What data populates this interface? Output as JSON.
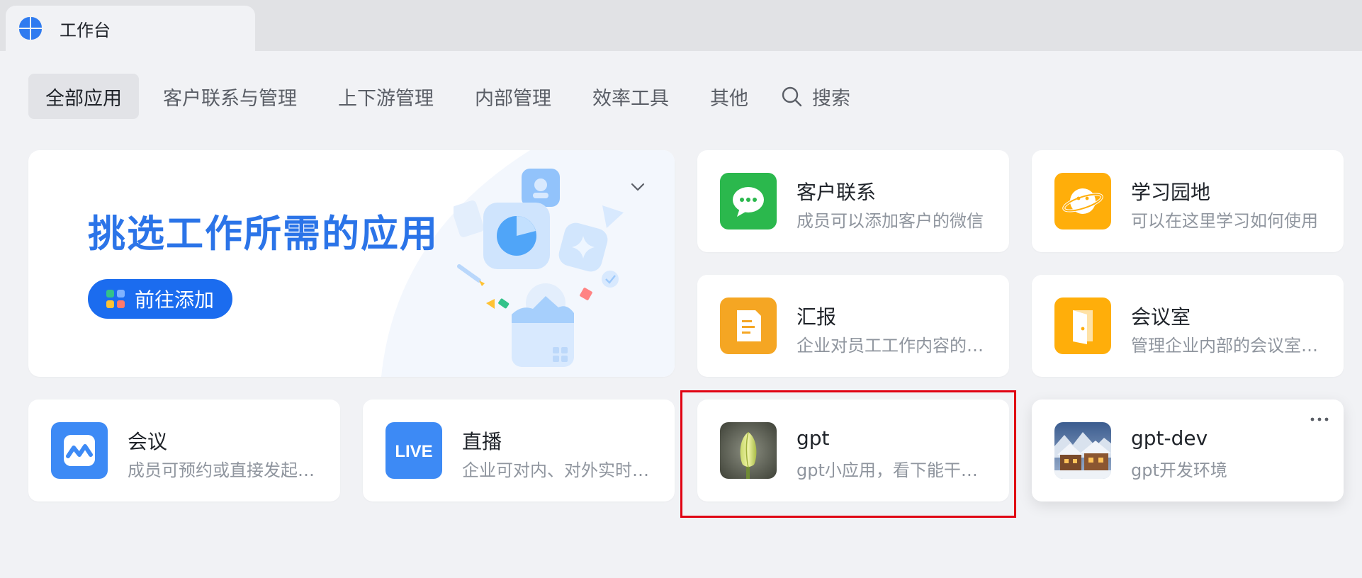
{
  "tab": {
    "title": "工作台"
  },
  "categories": [
    {
      "label": "全部应用",
      "active": true
    },
    {
      "label": "客户联系与管理",
      "active": false
    },
    {
      "label": "上下游管理",
      "active": false
    },
    {
      "label": "内部管理",
      "active": false
    },
    {
      "label": "效率工具",
      "active": false
    },
    {
      "label": "其他",
      "active": false
    }
  ],
  "search": {
    "label": "搜索",
    "icon": "search-icon"
  },
  "banner": {
    "headline": "挑选工作所需的应用",
    "button_label": "前往添加"
  },
  "apps": [
    {
      "name": "客户联系",
      "desc": "成员可以添加客户的微信",
      "icon": "chat-bubble-icon",
      "color": "#2bb84d"
    },
    {
      "name": "学习园地",
      "desc": "可以在这里学习如何使用",
      "icon": "planet-icon",
      "color": "#ffae0a"
    },
    {
      "name": "汇报",
      "desc": "企业对员工工作内容的汇报",
      "icon": "document-icon",
      "color": "#f5a623"
    },
    {
      "name": "会议室",
      "desc": "管理企业内部的会议室资源",
      "icon": "door-icon",
      "color": "#ffae0a"
    },
    {
      "name": "会议",
      "desc": "成员可预约或直接发起会议",
      "icon": "meeting-icon",
      "color": "#3d8af5"
    },
    {
      "name": "直播",
      "desc": "企业可对内、对外实时直播",
      "icon": "live-icon",
      "icon_text": "LIVE",
      "color": "#3d8af5"
    },
    {
      "name": "gpt",
      "desc": "gpt小应用，看下能干什么",
      "icon": "tulip-photo-icon"
    },
    {
      "name": "gpt-dev",
      "desc": "gpt开发环境",
      "icon": "snowy-cabin-photo-icon"
    }
  ],
  "colors": {
    "accent": "#1b6cef",
    "headline": "#2b74e8",
    "highlight": "#e00012"
  }
}
